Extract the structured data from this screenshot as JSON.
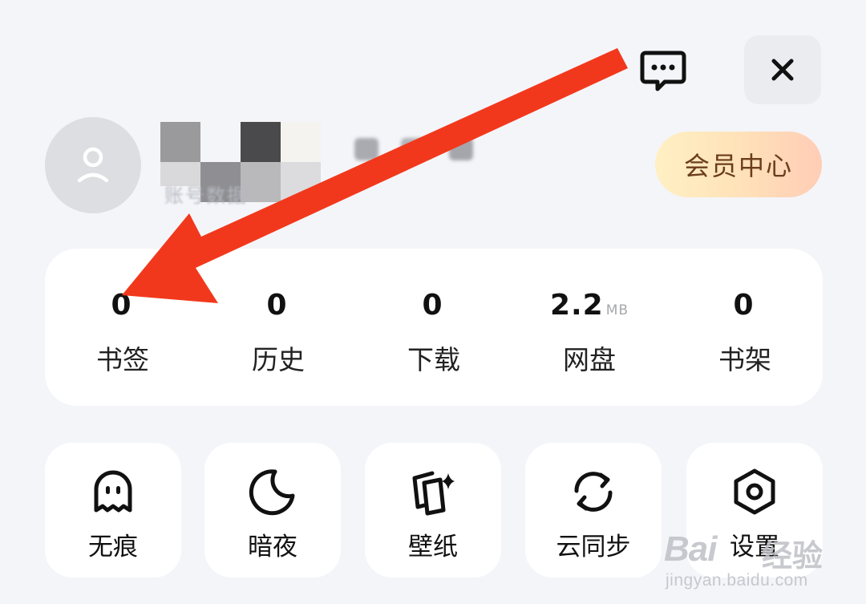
{
  "header": {
    "message_icon": "chat-bubble-dots-icon",
    "close_icon": "close-x-icon",
    "close_label": "✕"
  },
  "profile": {
    "avatar_icon": "user-silhouette-icon",
    "vip_center_label": "会员中心",
    "sub_text": "账号数据"
  },
  "stats": [
    {
      "value": "0",
      "unit": "",
      "label": "书签"
    },
    {
      "value": "0",
      "unit": "",
      "label": "历史"
    },
    {
      "value": "0",
      "unit": "",
      "label": "下载"
    },
    {
      "value": "2.2",
      "unit": "MB",
      "label": "网盘"
    },
    {
      "value": "0",
      "unit": "",
      "label": "书架"
    }
  ],
  "tools": [
    {
      "label": "无痕",
      "icon": "ghost-icon"
    },
    {
      "label": "暗夜",
      "icon": "moon-icon"
    },
    {
      "label": "壁纸",
      "icon": "wallpaper-icon"
    },
    {
      "label": "云同步",
      "icon": "sync-icon"
    },
    {
      "label": "设置",
      "icon": "settings-hexagon-icon"
    }
  ],
  "annotation": {
    "arrow_color": "#f2381c",
    "arrow_icon": "red-arrow-annotation"
  },
  "watermark": {
    "logo": "Bai",
    "cn": "经验",
    "url": "jingyan.baidu.com"
  },
  "colors": {
    "background": "#f4f5f9",
    "card": "#ffffff",
    "vip_gradient": [
      "#fff0c3",
      "#ffcdb6"
    ],
    "vip_text": "#6b3d1c"
  }
}
